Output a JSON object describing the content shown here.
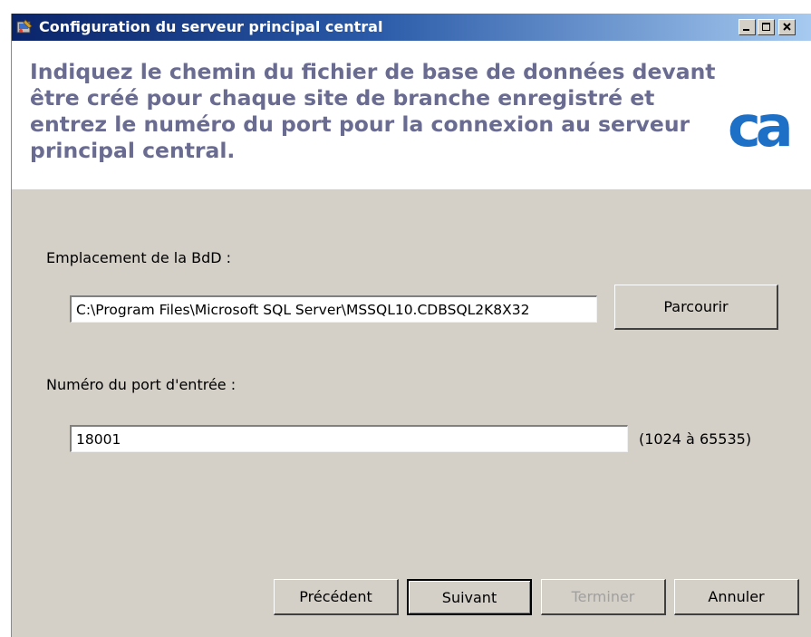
{
  "window": {
    "title": "Configuration du serveur principal central"
  },
  "header": {
    "instruction": "Indiquez le chemin du fichier de base de données devant être créé pour chaque site de branche enregistré et entrez le numéro du port pour la connexion au serveur principal central.",
    "logo_text": "ca",
    "logo_color": "#1e6fc6"
  },
  "form": {
    "db_location_label": "Emplacement de la BdD :",
    "db_location_value": "C:\\Program Files\\Microsoft SQL Server\\MSSQL10.CDBSQL2K8X32",
    "browse_label": "Parcourir",
    "port_label": "Numéro du port d'entrée :",
    "port_value": "18001",
    "port_range": "(1024 à 65535)"
  },
  "footer": {
    "previous_label": "Précédent",
    "next_label": "Suivant",
    "finish_label": "Terminer",
    "cancel_label": "Annuler"
  }
}
